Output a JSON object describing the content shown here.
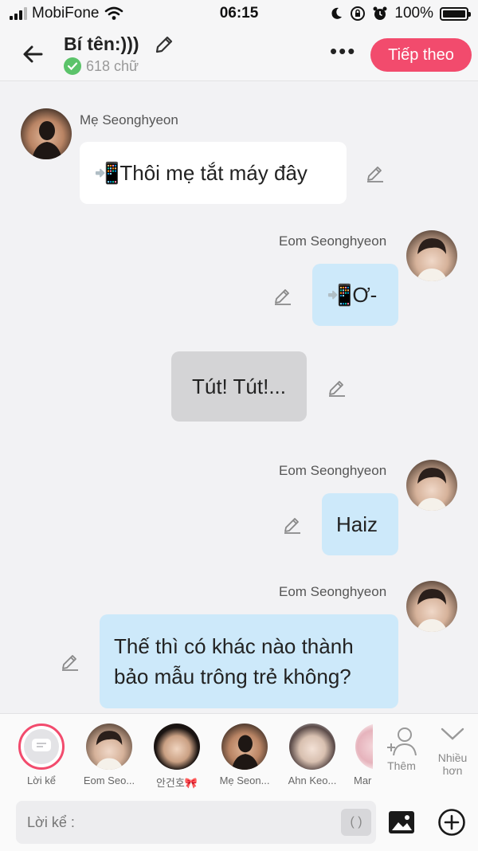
{
  "status_bar": {
    "carrier": "MobiFone",
    "time": "06:15",
    "battery": "100%"
  },
  "header": {
    "title": "Bí tên:)))",
    "word_count": "618 chữ",
    "next_label": "Tiếp theo"
  },
  "messages": [
    {
      "sender": "Mẹ Seonghyeon",
      "text": "📲Thôi mẹ tắt máy đây"
    },
    {
      "sender": "Eom Seonghyeon",
      "text": "📲Ơ-"
    },
    {
      "text": "Tút! Tút!..."
    },
    {
      "sender": "Eom Seonghyeon",
      "text": "Haiz"
    },
    {
      "sender": "Eom Seonghyeon",
      "line1": "Thế thì có khác nào thành",
      "line2": "bảo mẫu trông trẻ không?"
    }
  ],
  "characters": [
    {
      "name": "Lời kể"
    },
    {
      "name": "Eom Seo..."
    },
    {
      "name": "안건호🎀"
    },
    {
      "name": "Mẹ Seon..."
    },
    {
      "name": "Ahn Keo..."
    },
    {
      "name": "Mar"
    }
  ],
  "side_buttons": {
    "add_label": "Thêm",
    "more_label_1": "Nhiều",
    "more_label_2": "hơn"
  },
  "composer": {
    "placeholder": "Lời kể :",
    "paren_label": "( )"
  },
  "colors": {
    "accent": "#f24b6d",
    "bubble_blue": "#cde9fa",
    "bubble_gray": "#d4d4d6"
  }
}
